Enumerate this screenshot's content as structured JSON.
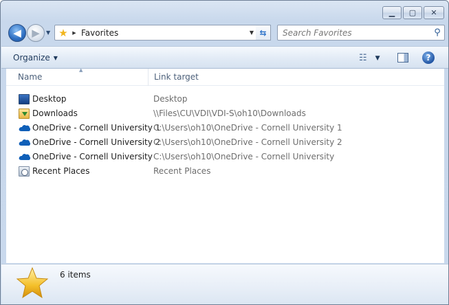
{
  "window": {
    "caption_buttons": [
      {
        "name": "minimize-button",
        "glyph": "▁"
      },
      {
        "name": "maximize-button",
        "glyph": "▢"
      },
      {
        "name": "close-button",
        "glyph": "✕"
      }
    ]
  },
  "nav": {
    "back_glyph": "◀",
    "forward_glyph": "▶",
    "address": {
      "icon": "star-icon",
      "text": "Favorites"
    },
    "search": {
      "placeholder": "Search Favorites"
    }
  },
  "toolbar": {
    "organize_label": "Organize"
  },
  "columns": {
    "name": "Name",
    "target": "Link target"
  },
  "items": [
    {
      "name": "Desktop",
      "target": "Desktop",
      "icon": "desktop-icon"
    },
    {
      "name": "Downloads",
      "target": "\\\\Files\\CU\\VDI\\VDI-S\\oh10\\Downloads",
      "icon": "downloads-folder-icon"
    },
    {
      "name": "OneDrive - Cornell University 1",
      "target": "C:\\Users\\oh10\\OneDrive - Cornell University 1",
      "icon": "onedrive-icon"
    },
    {
      "name": "OneDrive - Cornell University 2",
      "target": "C:\\Users\\oh10\\OneDrive - Cornell University 2",
      "icon": "onedrive-icon"
    },
    {
      "name": "OneDrive - Cornell University",
      "target": "C:\\Users\\oh10\\OneDrive - Cornell University",
      "icon": "onedrive-icon"
    },
    {
      "name": "Recent Places",
      "target": "Recent Places",
      "icon": "recent-places-icon"
    }
  ],
  "details": {
    "count_text": "6 items"
  },
  "colors": {
    "accent": "#2e6fc2",
    "onedrive": "#0f5fb8",
    "star": "#f1b51d"
  }
}
